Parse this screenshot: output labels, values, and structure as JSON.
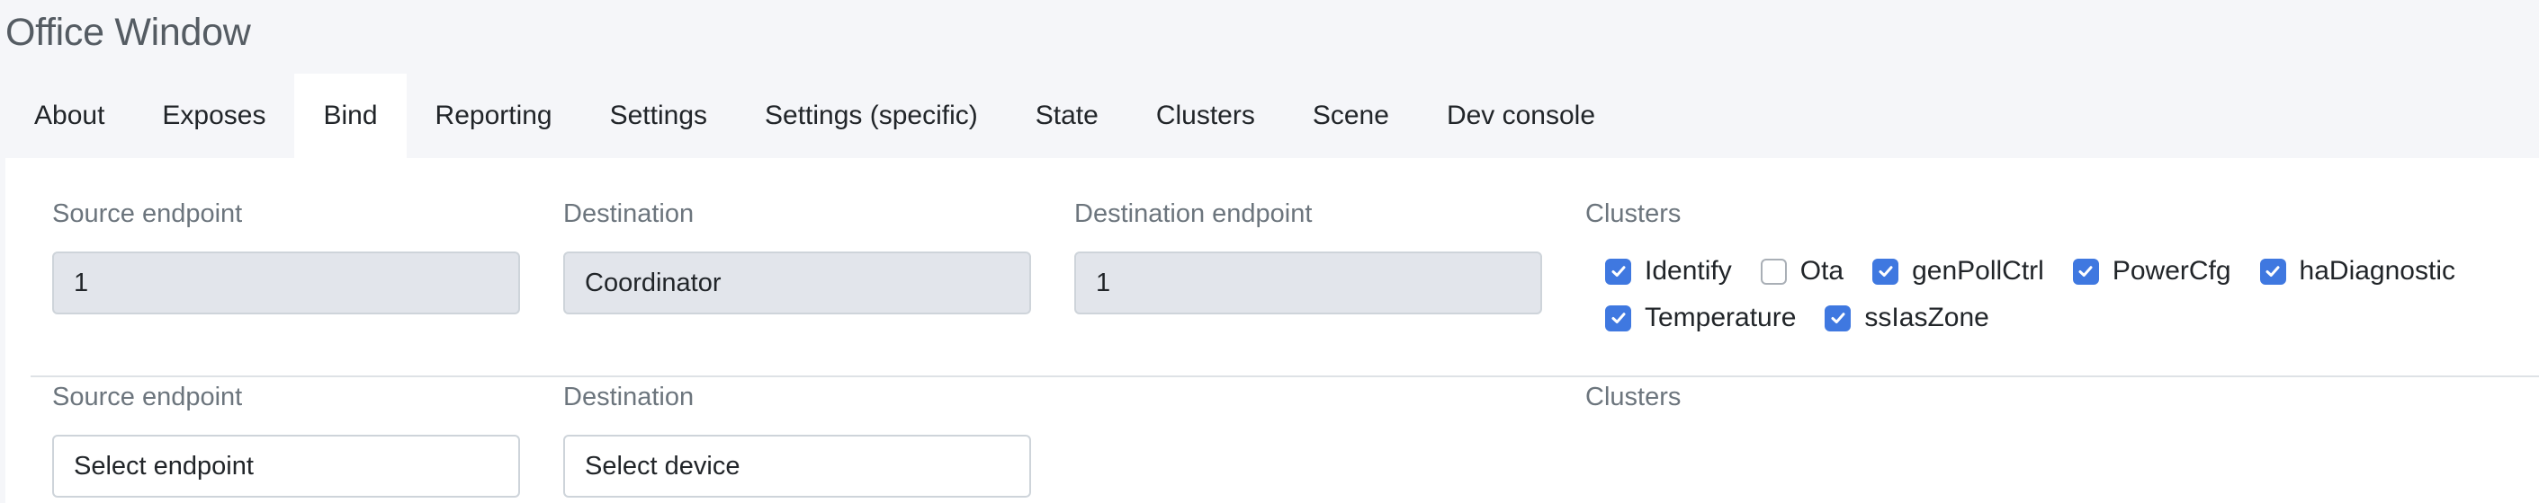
{
  "page": {
    "title": "Office Window"
  },
  "tabs": [
    {
      "label": "About",
      "active": false
    },
    {
      "label": "Exposes",
      "active": false
    },
    {
      "label": "Bind",
      "active": true
    },
    {
      "label": "Reporting",
      "active": false
    },
    {
      "label": "Settings",
      "active": false
    },
    {
      "label": "Settings (specific)",
      "active": false
    },
    {
      "label": "State",
      "active": false
    },
    {
      "label": "Clusters",
      "active": false
    },
    {
      "label": "Scene",
      "active": false
    },
    {
      "label": "Dev console",
      "active": false
    }
  ],
  "binding_row": {
    "source_endpoint_label": "Source endpoint",
    "source_endpoint_value": "1",
    "destination_label": "Destination",
    "destination_value": "Coordinator",
    "destination_endpoint_label": "Destination endpoint",
    "destination_endpoint_value": "1",
    "clusters_label": "Clusters",
    "clusters": [
      {
        "label": "Identify",
        "checked": true
      },
      {
        "label": "Ota",
        "checked": false
      },
      {
        "label": "genPollCtrl",
        "checked": true
      },
      {
        "label": "PowerCfg",
        "checked": true
      },
      {
        "label": "haDiagnostic",
        "checked": true
      },
      {
        "label": "Temperature",
        "checked": true
      },
      {
        "label": "ssIasZone",
        "checked": true
      }
    ]
  },
  "new_binding_row": {
    "source_endpoint_label": "Source endpoint",
    "source_endpoint_placeholder": "Select endpoint",
    "destination_label": "Destination",
    "destination_placeholder": "Select device",
    "clusters_label": "Clusters"
  },
  "colors": {
    "accent": "#3f78e0",
    "page_background": "#f5f6f9",
    "panel_background": "#ffffff",
    "disabled_field": "#e2e5eb",
    "label_text": "#6c757d"
  }
}
